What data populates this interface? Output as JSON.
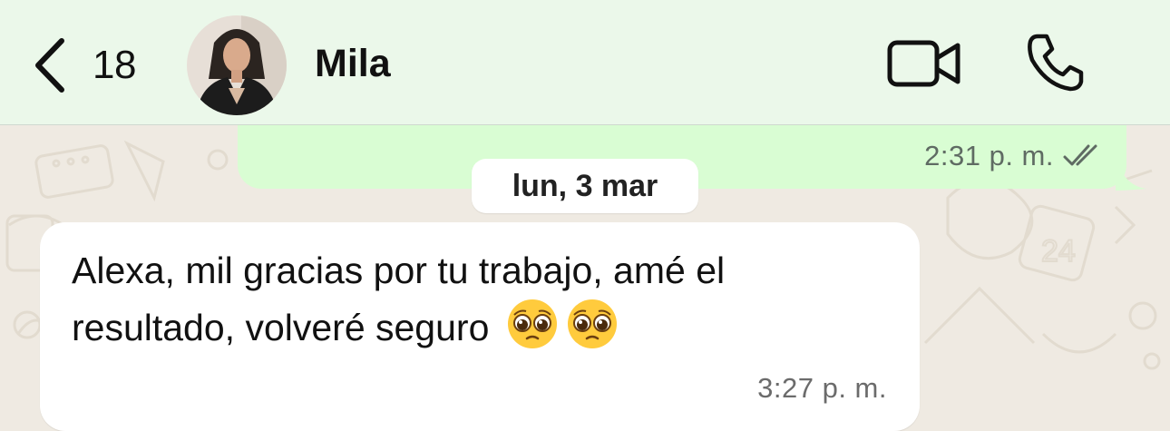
{
  "header": {
    "back_count": "18",
    "contact_name": "Mila",
    "back_icon": "chevron-left-icon",
    "video_icon": "video-camera-icon",
    "call_icon": "phone-icon"
  },
  "messages": {
    "outgoing": {
      "time": "2:31 p. m.",
      "status_icon": "double-check-icon"
    },
    "date_separator": "lun, 3 mar",
    "incoming": {
      "text": "Alexa, mil gracias por tu trabajo, amé el resultado, volveré seguro",
      "emoji_icon": "pleading-face-emoji",
      "time": "3:27 p. m."
    }
  },
  "colors": {
    "header_bg": "#ebf8ea",
    "outgoing_bubble": "#d9fdd3",
    "incoming_bubble": "#ffffff",
    "chat_bg": "#efeae2"
  }
}
